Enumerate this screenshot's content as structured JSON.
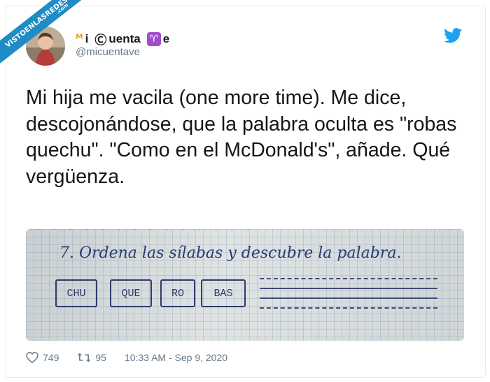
{
  "watermark": {
    "text": "VISTOENLASREDES",
    "suffix": ".com"
  },
  "author": {
    "name_prefix_glyph": "ᴹ",
    "name_mid": "i",
    "name_copyright_glyph": "Ⓒ",
    "name_word": "uenta",
    "name_aries_glyph": "♈",
    "name_suffix": "e",
    "handle": "@micuentave"
  },
  "tweet": {
    "text": "Mi hija me vacila (one more time). Me dice, descojonándose, que la palabra oculta es \"robas quechu\". \"Como en el McDonald's\", añade. Qué vergüenza."
  },
  "photo": {
    "exercise": "7. Ordena las sílabas y descubre la palabra.",
    "syllables": [
      "CHU",
      "QUE",
      "RO",
      "BAS"
    ]
  },
  "stats": {
    "likes": "749",
    "retweets": "95",
    "timestamp": "10:33 AM - Sep 9, 2020"
  },
  "colors": {
    "twitter_blue": "#1da1f2",
    "ribbon": "#1f8cc6",
    "ink": "#2a3a70"
  }
}
